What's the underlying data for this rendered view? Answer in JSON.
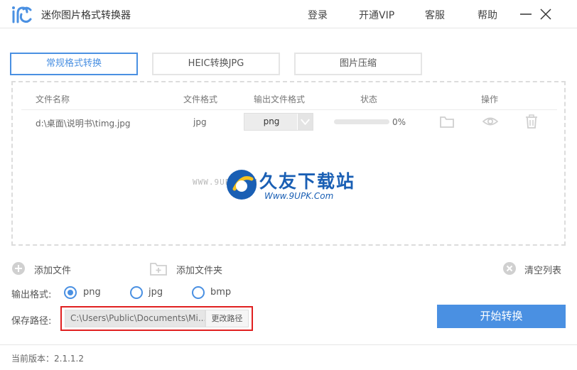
{
  "app": {
    "title": "迷你图片格式转换器"
  },
  "nav": {
    "login": "登录",
    "vip": "开通VIP",
    "service": "客服",
    "help": "帮助"
  },
  "tabs": [
    {
      "label": "常规格式转换",
      "active": true
    },
    {
      "label": "HEIC转换JPG",
      "active": false
    },
    {
      "label": "图片压缩",
      "active": false
    }
  ],
  "table": {
    "headers": {
      "name": "文件名称",
      "format": "文件格式",
      "output": "输出文件格式",
      "status": "状态",
      "ops": "操作"
    },
    "rows": [
      {
        "name": "d:\\桌面\\说明书\\timg.jpg",
        "format": "jpg",
        "output": "png",
        "progress_label": "0%",
        "progress": 0
      }
    ]
  },
  "watermark": {
    "small": "WWW.9UPK.COM",
    "big": "久友下载站",
    "url": "Www.9UPK.Com"
  },
  "actions": {
    "add_file": "添加文件",
    "add_folder": "添加文件夹",
    "clear_list": "清空列表"
  },
  "output_format": {
    "label": "输出格式:",
    "options": [
      {
        "label": "png",
        "checked": true
      },
      {
        "label": "jpg",
        "checked": false
      },
      {
        "label": "bmp",
        "checked": false
      }
    ]
  },
  "save_path": {
    "label": "保存路径:",
    "value": "C:\\Users\\Public\\Documents\\Mi...",
    "change_label": "更改路径"
  },
  "start_button": "开始转换",
  "footer": {
    "version_label": "当前版本：2.1.1.2"
  },
  "colors": {
    "accent": "#4a90e2",
    "highlight": "#e02020",
    "watermark": "#1a5fb4"
  }
}
